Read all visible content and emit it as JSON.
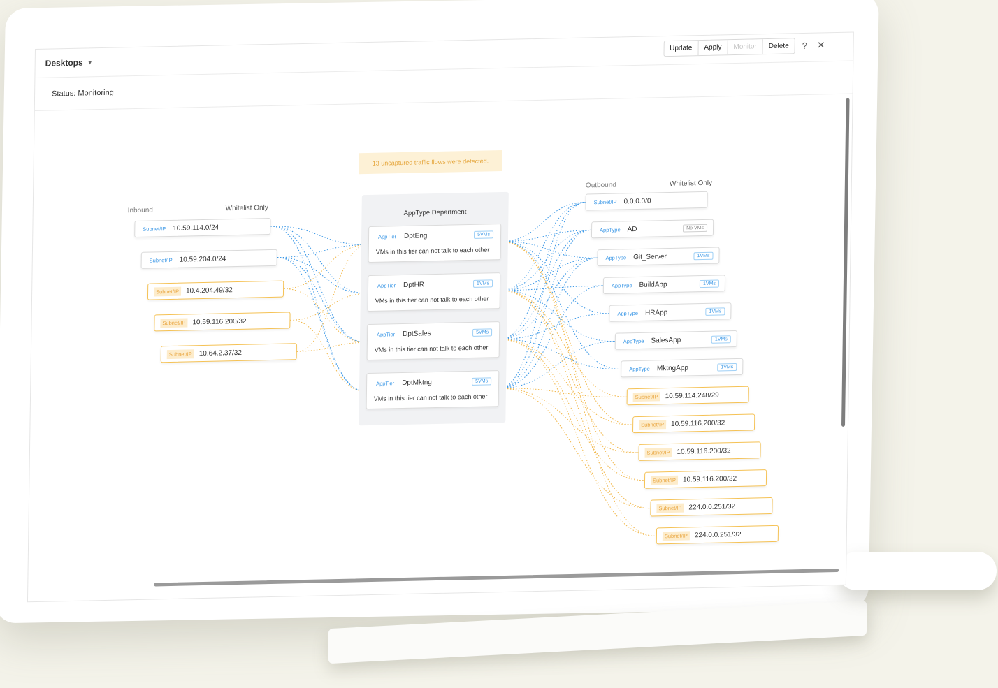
{
  "header": {
    "context": "Desktops",
    "actions": [
      "Update",
      "Apply",
      "Monitor",
      "Delete"
    ],
    "help": "?",
    "close": "✕"
  },
  "status": "Status: Monitoring",
  "banner": "13 uncaptured traffic flows were detected.",
  "inbound": {
    "title": "Inbound",
    "mode": "Whitelist Only",
    "items": [
      {
        "tag": "Subnet/IP",
        "value": "10.59.114.0/24",
        "warn": false
      },
      {
        "tag": "Subnet/IP",
        "value": "10.59.204.0/24",
        "warn": false
      },
      {
        "tag": "Subnet/IP",
        "value": "10.4.204.49/32",
        "warn": true
      },
      {
        "tag": "Subnet/IP",
        "value": "10.59.116.200/32",
        "warn": true
      },
      {
        "tag": "Subnet/IP",
        "value": "10.64.2.37/32",
        "warn": true
      }
    ]
  },
  "apptype": {
    "title": "AppType Department",
    "tiers": [
      {
        "tag": "AppTier",
        "name": "DptEng",
        "badge": "5VMs",
        "desc": "VMs in this tier can not talk to each other"
      },
      {
        "tag": "AppTier",
        "name": "DptHR",
        "badge": "5VMs",
        "desc": "VMs in this tier can not talk to each other"
      },
      {
        "tag": "AppTier",
        "name": "DptSales",
        "badge": "5VMs",
        "desc": "VMs in this tier can not talk to each other"
      },
      {
        "tag": "AppTier",
        "name": "DptMktng",
        "badge": "5VMs",
        "desc": "VMs in this tier can not talk to each other"
      }
    ]
  },
  "outbound": {
    "title": "Outbound",
    "mode": "Whitelist Only",
    "items": [
      {
        "tag": "Subnet/IP",
        "value": "0.0.0.0/0",
        "badge": "",
        "warn": false
      },
      {
        "tag": "AppType",
        "value": "AD",
        "badge": "No VMs",
        "warn": false
      },
      {
        "tag": "AppType",
        "value": "Git_Server",
        "badge": "1VMs",
        "warn": false
      },
      {
        "tag": "AppType",
        "value": "BuildApp",
        "badge": "1VMs",
        "warn": false
      },
      {
        "tag": "AppType",
        "value": "HRApp",
        "badge": "1VMs",
        "warn": false
      },
      {
        "tag": "AppType",
        "value": "SalesApp",
        "badge": "1VMs",
        "warn": false
      },
      {
        "tag": "AppType",
        "value": "MktngApp",
        "badge": "1VMs",
        "warn": false
      },
      {
        "tag": "Subnet/IP",
        "value": "10.59.114.248/29",
        "badge": "",
        "warn": true
      },
      {
        "tag": "Subnet/IP",
        "value": "10.59.116.200/32",
        "badge": "",
        "warn": true
      },
      {
        "tag": "Subnet/IP",
        "value": "10.59.116.200/32",
        "badge": "",
        "warn": true
      },
      {
        "tag": "Subnet/IP",
        "value": "10.59.116.200/32",
        "badge": "",
        "warn": true
      },
      {
        "tag": "Subnet/IP",
        "value": "224.0.0.251/32",
        "badge": "",
        "warn": true
      },
      {
        "tag": "Subnet/IP",
        "value": "224.0.0.251/32",
        "badge": "",
        "warn": true
      }
    ]
  },
  "colors": {
    "blue": "#3a97e6",
    "orange": "#f2b84b",
    "gray": "#f1f2f4"
  }
}
